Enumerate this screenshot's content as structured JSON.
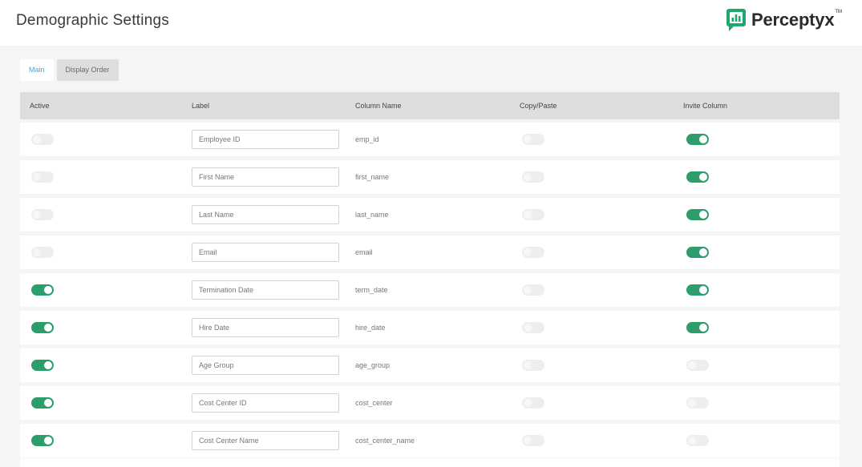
{
  "header": {
    "title": "Demographic Settings",
    "logo_text": "Perceptyx",
    "logo_tm": "TM",
    "brand_color": "#1ea86e"
  },
  "tabs": [
    {
      "label": "Main",
      "active": true
    },
    {
      "label": "Display Order",
      "active": false
    }
  ],
  "table": {
    "headers": {
      "active": "Active",
      "label": "Label",
      "column_name": "Column Name",
      "copy_paste": "Copy/Paste",
      "invite_column": "Invite Column"
    },
    "rows": [
      {
        "active": false,
        "label": "Employee ID",
        "column_name": "emp_id",
        "copy_paste": false,
        "invite_column": true
      },
      {
        "active": false,
        "label": "First Name",
        "column_name": "first_name",
        "copy_paste": false,
        "invite_column": true
      },
      {
        "active": false,
        "label": "Last Name",
        "column_name": "last_name",
        "copy_paste": false,
        "invite_column": true
      },
      {
        "active": false,
        "label": "Email",
        "column_name": "email",
        "copy_paste": false,
        "invite_column": true
      },
      {
        "active": true,
        "label": "Termination Date",
        "column_name": "term_date",
        "copy_paste": false,
        "invite_column": true
      },
      {
        "active": true,
        "label": "Hire Date",
        "column_name": "hire_date",
        "copy_paste": false,
        "invite_column": true
      },
      {
        "active": true,
        "label": "Age Group",
        "column_name": "age_group",
        "copy_paste": false,
        "invite_column": false
      },
      {
        "active": true,
        "label": "Cost Center ID",
        "column_name": "cost_center",
        "copy_paste": false,
        "invite_column": false
      },
      {
        "active": true,
        "label": "Cost Center Name",
        "column_name": "cost_center_name",
        "copy_paste": false,
        "invite_column": false
      }
    ]
  },
  "colors": {
    "toggle_on": "#2d9e6b",
    "toggle_off": "#eceef0",
    "tab_active_text": "#3fa8d8"
  }
}
